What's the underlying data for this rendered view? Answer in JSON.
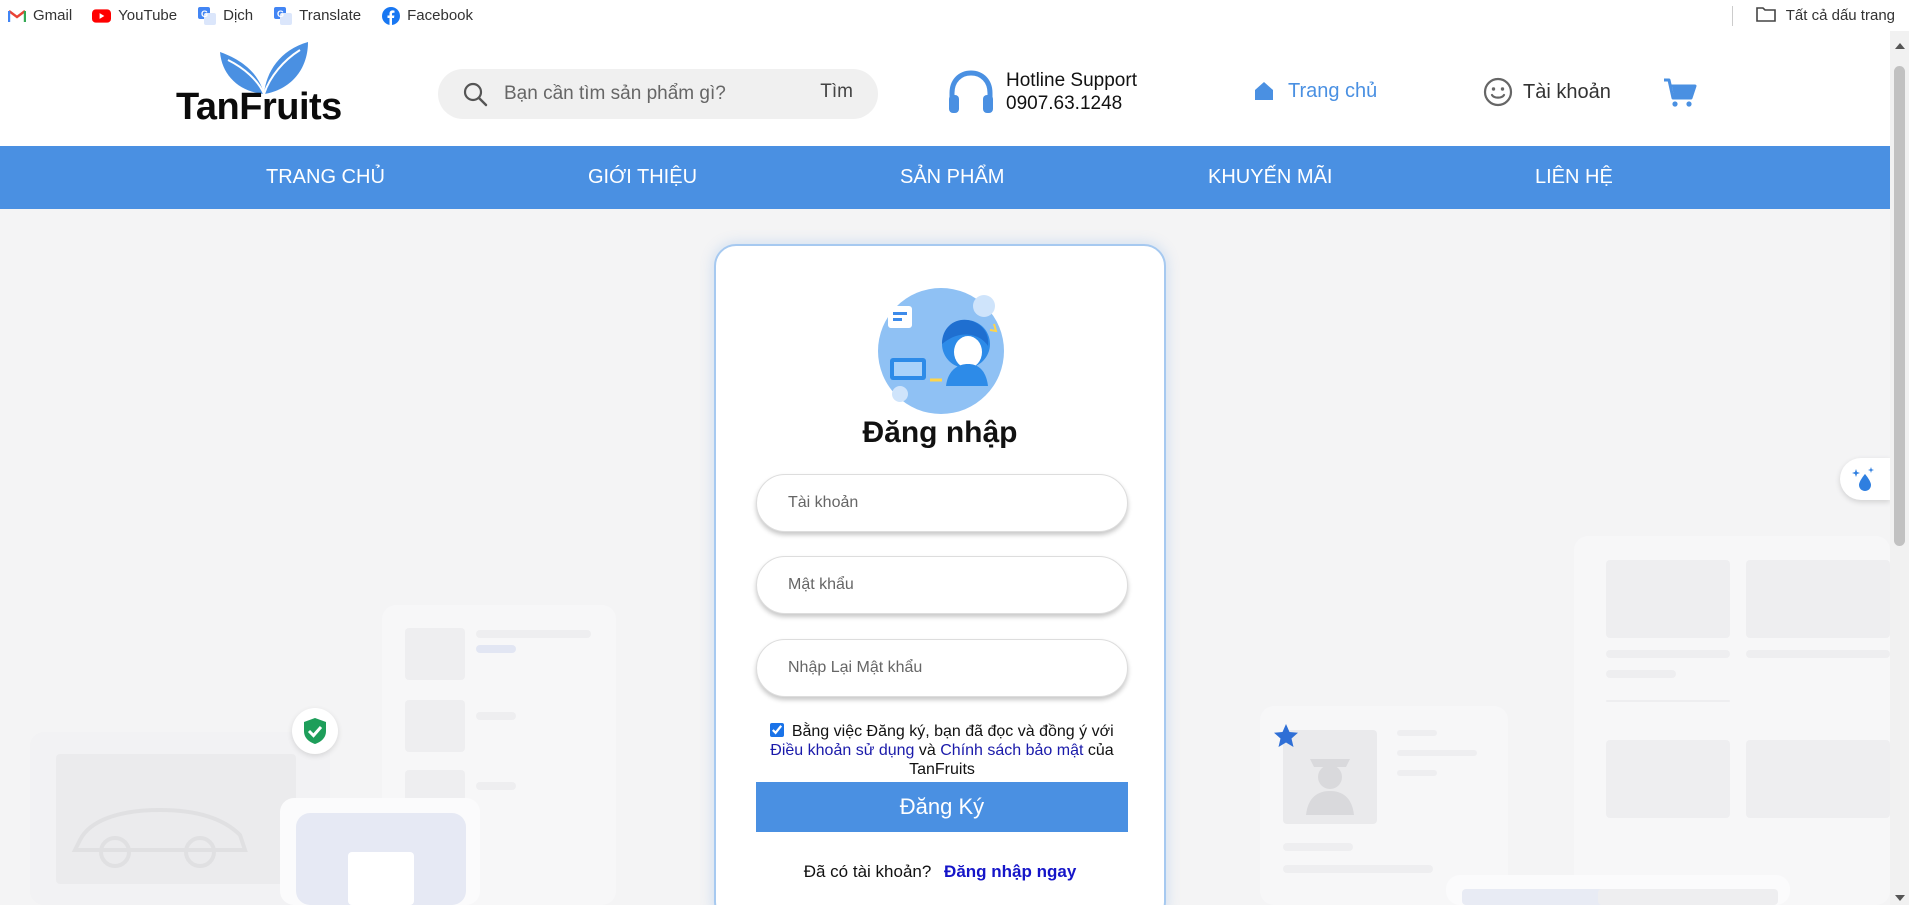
{
  "bookmarks": {
    "items": [
      {
        "label": "Gmail",
        "icon": "gmail-icon"
      },
      {
        "label": "YouTube",
        "icon": "youtube-icon"
      },
      {
        "label": "Dịch",
        "icon": "translate-icon"
      },
      {
        "label": "Translate",
        "icon": "translate-icon"
      },
      {
        "label": "Facebook",
        "icon": "facebook-icon"
      }
    ],
    "all_bookmarks": "Tất cả dấu trang"
  },
  "header": {
    "logo_text": "TanFruits",
    "search_placeholder": "Bạn cần tìm sản phẩm gì?",
    "search_button": "Tìm",
    "hotline_title": "Hotline Support",
    "hotline_number": "0907.63.1248",
    "home_label": "Trang chủ",
    "account_label": "Tài khoản"
  },
  "nav": {
    "items": [
      "TRANG CHỦ",
      "GIỚI THIỆU",
      "SẢN PHẨM",
      "KHUYẾN MÃI",
      "LIÊN HỆ"
    ]
  },
  "form": {
    "title": "Đăng nhập",
    "username_placeholder": "Tài khoản",
    "password_placeholder": "Mật khẩu",
    "confirm_placeholder": "Nhập Lại Mật khẩu",
    "terms_prefix": "Bằng việc Đăng ký, bạn đã đọc và đồng ý với",
    "terms_link": "Điều khoản sử dụng",
    "terms_and": "và",
    "privacy_link": "Chính sách bảo mật",
    "terms_suffix": "của TanFruits",
    "terms_checked": true,
    "submit_label": "Đăng Ký",
    "have_account": "Đã có tài khoản?",
    "login_now": "Đăng nhập ngay"
  },
  "colors": {
    "primary": "#4a90e2",
    "link": "#1a1aaa",
    "background": "#f4f4f5"
  }
}
